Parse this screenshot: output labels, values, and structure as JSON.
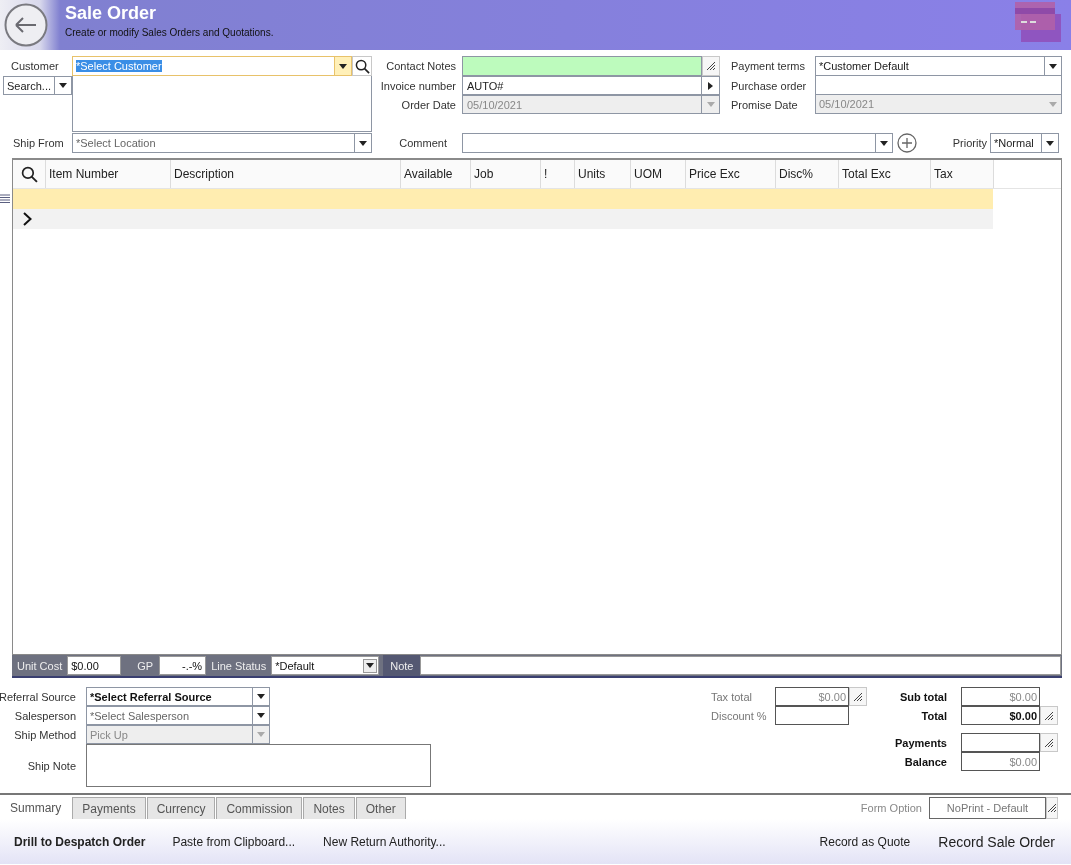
{
  "header": {
    "title": "Sale Order",
    "subtitle": "Create or modify Sales Orders and Quotations."
  },
  "customer": {
    "label": "Customer",
    "value": "*Select Customer",
    "text_selected": true,
    "search_mode": "Search..."
  },
  "ship_from": {
    "label": "Ship From",
    "placeholder": "*Select Location"
  },
  "middle_fields": [
    {
      "label": "Contact Notes",
      "kind": "notes",
      "disabled": false
    },
    {
      "label": "Invoice number",
      "value": "AUTO#",
      "kind": "lookup",
      "disabled": false
    },
    {
      "label": "Order Date",
      "value": "05/10/2021",
      "kind": "date",
      "disabled": true
    }
  ],
  "right_fields": [
    {
      "label": "Payment terms",
      "value": "*Customer Default",
      "kind": "combo",
      "disabled": false
    },
    {
      "label": "Purchase order",
      "kind": "text",
      "disabled": false
    },
    {
      "label": "Promise Date",
      "value": "05/10/2021",
      "kind": "date",
      "disabled": true
    }
  ],
  "comment": {
    "label": "Comment"
  },
  "priority": {
    "label": "Priority",
    "value": "*Normal"
  },
  "grid": {
    "columns": [
      {
        "kind": "search"
      },
      {
        "label": "Item Number"
      },
      {
        "label": "Description"
      },
      {
        "label": "Available"
      },
      {
        "label": "Job"
      },
      {
        "label": "!"
      },
      {
        "label": "Units"
      },
      {
        "label": "UOM"
      },
      {
        "label": "Price Exc"
      },
      {
        "label": "Disc%"
      },
      {
        "label": "Total Exc"
      },
      {
        "label": "Tax"
      }
    ],
    "rows": [
      {
        "kind": "current"
      },
      {
        "kind": "new"
      }
    ]
  },
  "line_bar": {
    "unit_cost_label": "Unit Cost",
    "unit_cost": "$0.00",
    "gp_label": "GP",
    "gp": "-.-%",
    "status_label": "Line Status",
    "status": "*Default",
    "note_label": "Note"
  },
  "order_details": [
    {
      "label": "Referral Source",
      "value": "*Select Referral Source",
      "disabled": false
    },
    {
      "label": "Salesperson",
      "placeholder": "*Select Salesperson",
      "disabled": false
    },
    {
      "label": "Ship Method",
      "value": "Pick Up",
      "disabled": true
    }
  ],
  "ship_note": {
    "label": "Ship Note"
  },
  "tax": [
    {
      "label": "Tax total",
      "value": "$0.00",
      "button": true
    },
    {
      "label": "Discount %",
      "button": false
    }
  ],
  "totals": [
    {
      "label": "Sub total",
      "value": "$0.00",
      "button": false,
      "emphasis": false
    },
    {
      "label": "Total",
      "value": "$0.00",
      "button": true,
      "emphasis": true
    }
  ],
  "payments": [
    {
      "label": "Payments",
      "button": true
    },
    {
      "label": "Balance",
      "value": "$0.00",
      "button": false
    }
  ],
  "tabs": [
    {
      "label": "Summary",
      "selected": true
    },
    {
      "label": "Payments",
      "selected": false
    },
    {
      "label": "Currency",
      "selected": false
    },
    {
      "label": "Commission",
      "selected": false
    },
    {
      "label": "Notes",
      "selected": false
    },
    {
      "label": "Other",
      "selected": false
    }
  ],
  "form_option": {
    "label": "Form Option",
    "value": "NoPrint - Default"
  },
  "actions": [
    {
      "label": "Drill to Despatch Order",
      "kind": "primary"
    },
    {
      "label": "Paste from Clipboard...",
      "kind": "link"
    },
    {
      "label": "New Return Authority...",
      "kind": "link"
    }
  ],
  "right_actions": [
    {
      "label": "Record as Quote",
      "kind": "link"
    },
    {
      "label": "Record Sale Order",
      "kind": "main"
    }
  ]
}
